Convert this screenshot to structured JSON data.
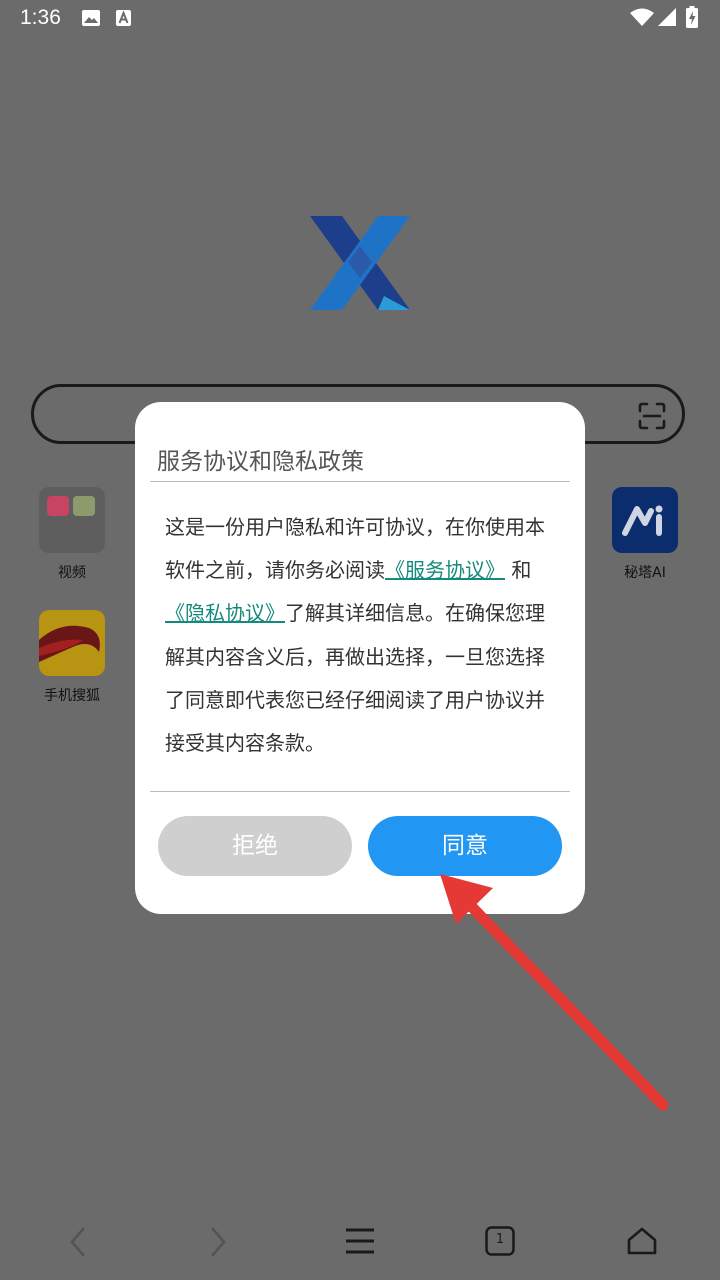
{
  "status_bar": {
    "time": "1:36",
    "icons": [
      "image-icon",
      "font-a-icon",
      "wifi-icon",
      "signal-icon",
      "battery-charging-icon"
    ]
  },
  "search": {
    "placeholder": ""
  },
  "apps": [
    {
      "label": "视频",
      "icon": "video-folder-icon"
    },
    {
      "label": "秘塔AI",
      "icon": "metaso-ai-icon"
    },
    {
      "label": "手机搜狐",
      "icon": "sohu-fox-icon"
    }
  ],
  "dialog": {
    "title": "服务协议和隐私政策",
    "body_1": "这是一份用户隐私和许可协议，在你使用本软件之前，请你务必阅读",
    "link_service": "《服务协议》",
    "body_2": " 和 ",
    "link_privacy": "《隐私协议》",
    "body_3": "了解其详细信息。在确保您理解其内容含义后，再做出选择，一旦您选择了同意即代表您已经仔细阅读了用户协议并接受其内容条款。",
    "reject_label": "拒绝",
    "agree_label": "同意"
  },
  "nav": {
    "tab_count": "1",
    "icons": [
      "back-icon",
      "forward-icon",
      "menu-icon",
      "tabs-icon",
      "home-icon"
    ]
  },
  "colors": {
    "scrim": "#6b6b6b",
    "accent": "#2196f3",
    "link": "#138a7b",
    "reject_button": "#cfcfcf",
    "annotation_arrow": "#e53935"
  }
}
